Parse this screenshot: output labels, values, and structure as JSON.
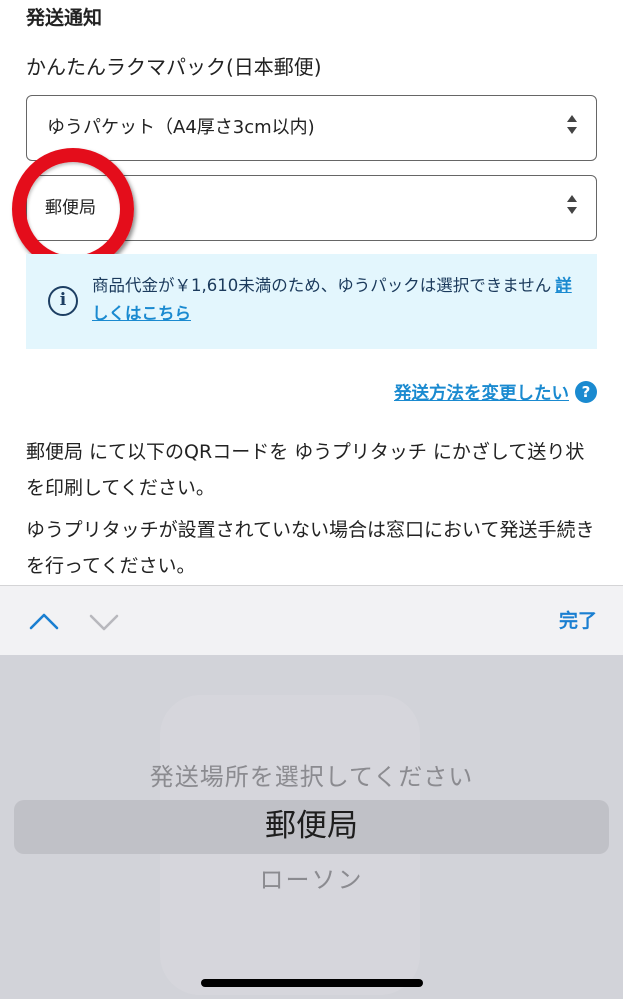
{
  "section_title": "発送通知",
  "carrier": "かんたんラクマパック(日本郵便)",
  "package_select": {
    "value": "ゆうパケット（A4厚さ3cm以内)"
  },
  "place_select": {
    "value": "郵便局"
  },
  "notice": {
    "message": "商品代金が￥1,610未満のため、ゆうパックは選択できません",
    "link": "詳しくはこちら"
  },
  "change_link": {
    "label": "発送方法を変更したい",
    "help": "?"
  },
  "instructions": [
    "郵便局 にて以下のQRコードを ゆうプリタッチ にかざして送り状を印刷してください。",
    "ゆうプリタッチが設置されていない場合は窓口において発送手続きを行ってください。"
  ],
  "toolbar": {
    "done_label": "完了"
  },
  "picker": {
    "options": [
      "発送場所を選択してください",
      "郵便局",
      "ローソン"
    ],
    "selected_index": 1
  },
  "colors": {
    "link_blue": "#1a8ad0",
    "notice_bg": "#e3f6fd",
    "annotation_red": "#e40d1b",
    "picker_bg": "#d2d3d9"
  }
}
